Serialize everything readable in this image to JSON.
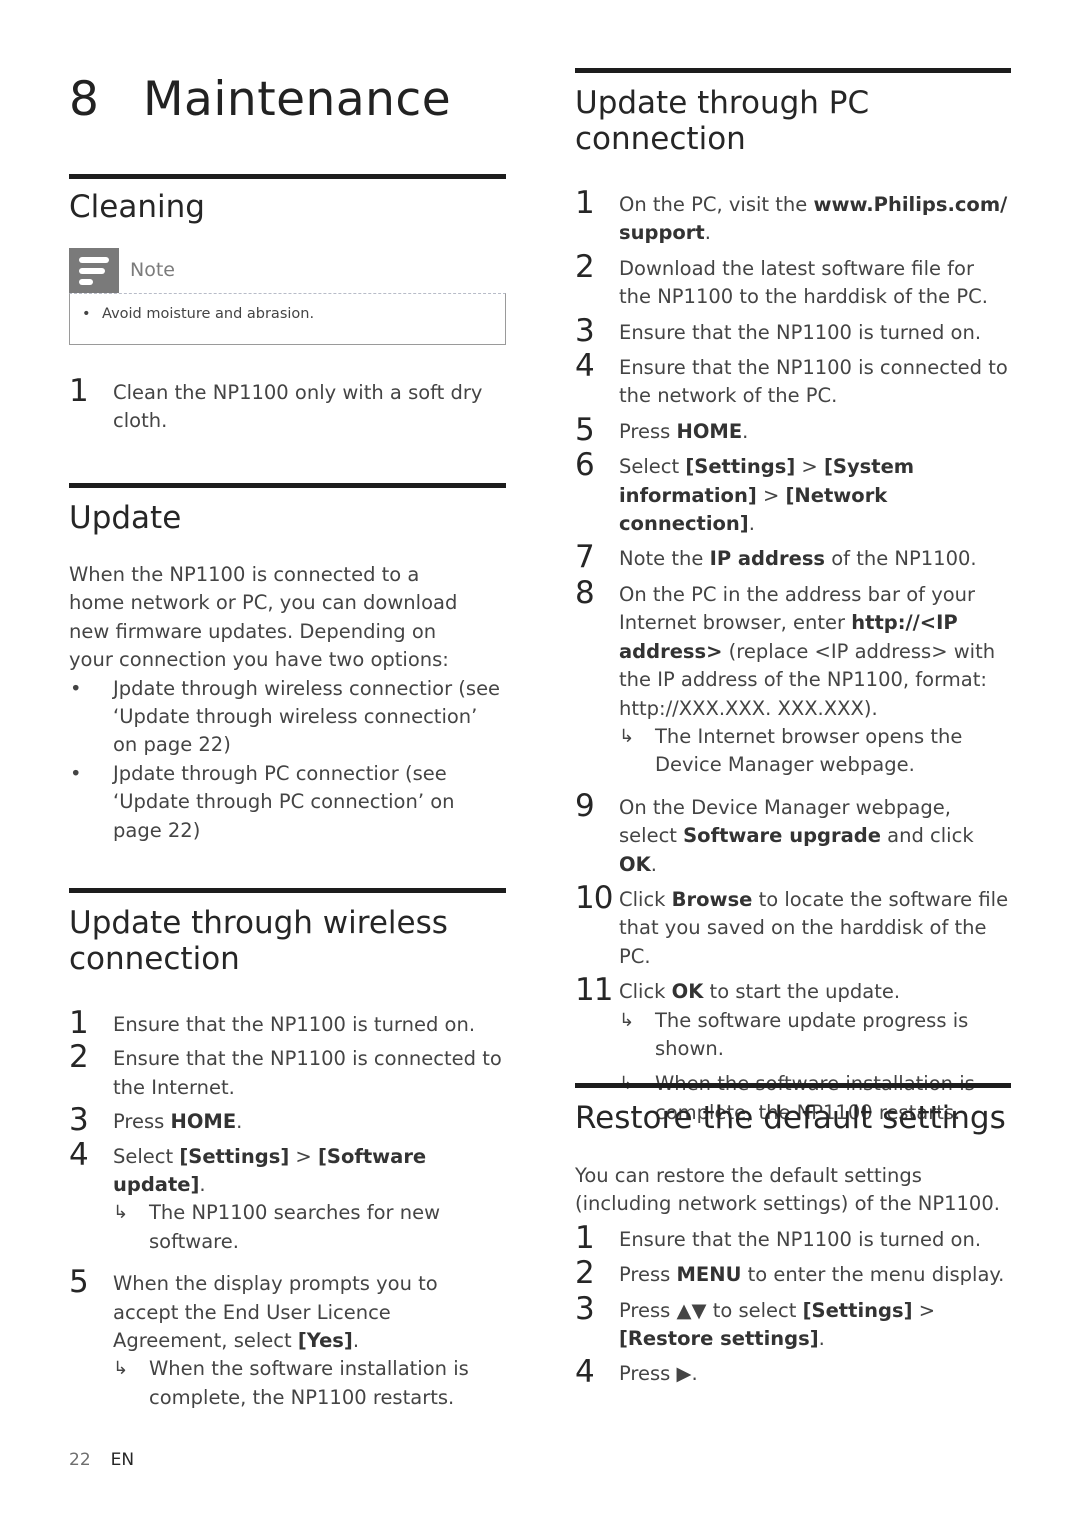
{
  "chapter": {
    "number": "8",
    "title": "Maintenance"
  },
  "left_column": {
    "cleaning": {
      "title": "Cleaning",
      "note": {
        "icon": "note-lines-icon",
        "label": "Note",
        "bullet": "•",
        "text": "Avoid moisture and abrasion."
      },
      "steps": [
        {
          "num": "1",
          "text": "Clean the NP1100 only with a soft dry cloth."
        }
      ]
    },
    "update": {
      "title": "Update",
      "intro": "When the NP1100 is connected to a home network or PC, you can download new firmware updates. Depending on your connection you have two options:",
      "bullets": [
        {
          "dot": "•",
          "text": "Jpdate through wireless connectior (see ‘Update through wireless connection’ on page 22)"
        },
        {
          "dot": "•",
          "text": "Jpdate through PC connectior (see ‘Update through PC connection’ on page 22)"
        }
      ]
    },
    "wireless": {
      "title": "Update through wireless connection",
      "steps": [
        {
          "num": "1",
          "parts": [
            "Ensure that the NP1100 is turned on."
          ]
        },
        {
          "num": "2",
          "parts": [
            "Ensure that the NP1100 is connected to the Internet."
          ]
        },
        {
          "num": "3",
          "pre": "Press ",
          "bold1": "HOME",
          "post": "."
        },
        {
          "num": "4",
          "pre": "Select ",
          "bold1": "[Settings]",
          "mid": " > ",
          "bold2": "[Software update]",
          "post": ".",
          "result": "The NP1100 searches for new software."
        },
        {
          "num": "5",
          "pre": "When the display prompts you to accept the End User Licence Agreement, select ",
          "bold1": "[Yes]",
          "post": ".",
          "result": "When the software installation is complete, the NP1100 restarts."
        }
      ]
    }
  },
  "right_column": {
    "pc": {
      "title": "Update through PC connection",
      "steps": [
        {
          "num": "1",
          "pre": "On the PC, visit the ",
          "bold1": "www.Philips.com/ support",
          "post": "."
        },
        {
          "num": "2",
          "text": "Download the latest software file for the NP1100 to the harddisk of the PC."
        },
        {
          "num": "3",
          "text": "Ensure that the NP1100 is turned on."
        },
        {
          "num": "4",
          "text": "Ensure that the NP1100 is connected to the network of the PC."
        },
        {
          "num": "5",
          "pre": "Press ",
          "bold1": "HOME",
          "post": "."
        },
        {
          "num": "6",
          "pre": "Select ",
          "bold1": "[Settings]",
          "mid": " > ",
          "bold2": "[System information]",
          "mid2": " > ",
          "bold3": "[Network connection]",
          "post": "."
        },
        {
          "num": "7",
          "pre": "Note the ",
          "bold1": "IP address",
          "post": " of the NP1100."
        },
        {
          "num": "8",
          "pre": "On the PC in the address bar of your Internet browser, enter ",
          "bold1": "http://<IP address>",
          "post": " (replace <IP address> with the IP address of the NP1100, format: http://XXX.XXX. XXX.XXX).",
          "result": "The Internet browser opens the Device Manager webpage."
        },
        {
          "num": "9",
          "pre": "On the Device Manager webpage, select ",
          "bold1": "Software upgrade",
          "mid": " and click ",
          "bold2": "OK",
          "post": "."
        },
        {
          "num": "10",
          "pre": "Click ",
          "bold1": "Browse",
          "post": " to locate the software file that you saved on the harddisk of the PC."
        },
        {
          "num": "11",
          "pre": "Click ",
          "bold1": "OK",
          "post": " to start the update.",
          "result": "The software update progress is shown.",
          "result2": "When the software installation is complete, the NP1100 restarts."
        }
      ]
    },
    "restore": {
      "title": "Restore the default settings",
      "intro": "You can restore the default settings (including network settings) of the NP1100.",
      "steps": [
        {
          "num": "1",
          "text": "Ensure that the NP1100 is turned on."
        },
        {
          "num": "2",
          "pre": "Press ",
          "bold1": "MENU",
          "post": " to enter the menu display."
        },
        {
          "num": "3",
          "pre": "Press ▲▼ to select ",
          "bold1": "[Settings]",
          "mid": " > ",
          "bold2": "[Restore settings]",
          "post": "."
        },
        {
          "num": "4",
          "text": "Press ▶."
        }
      ]
    }
  },
  "result_arrow": "↳",
  "footer": {
    "page": "22",
    "language": "EN"
  }
}
